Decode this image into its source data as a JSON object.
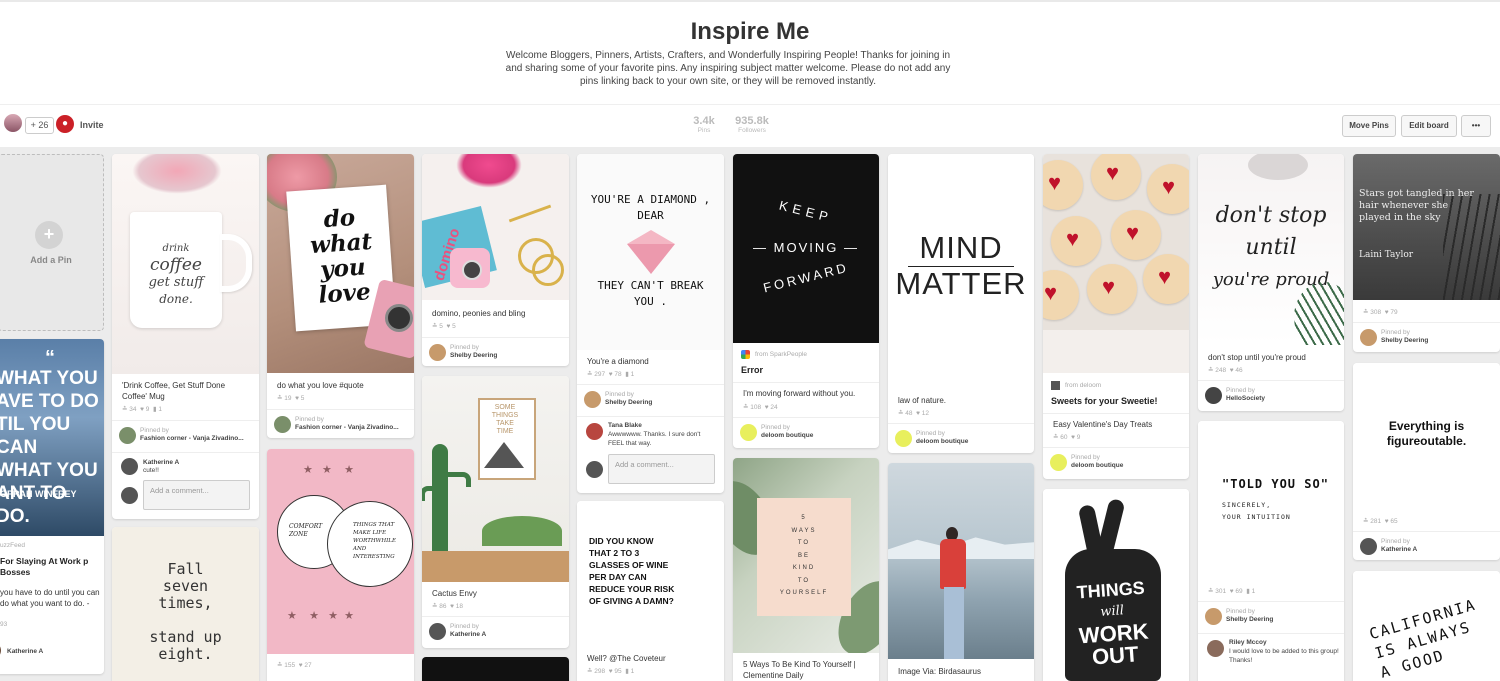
{
  "board": {
    "title": "Inspire Me",
    "description": "Welcome Bloggers, Pinners, Artists, Crafters, and Wonderfully Inspiring People! Thanks for joining in and sharing some of your favorite pins. Any inspiring subject matter welcome. Please do not add any pins linking back to your own site, or they will be removed instantly."
  },
  "toolbar": {
    "collaborators": "+ 26",
    "invite": "Invite",
    "pins_count": "3.4k",
    "pins_label": "Pins",
    "followers_count": "935.8k",
    "followers_label": "Followers",
    "move_pins": "Move Pins",
    "edit_board": "Edit board",
    "more": "•••"
  },
  "add_pin": "Add a Pin",
  "pins": {
    "oprah": {
      "img_text": [
        "“",
        "WHAT YOU",
        "AVE TO DO",
        "TIL YOU CAN",
        "WHAT YOU",
        "ANT TO DO.",
        "OPRAH WINFREY"
      ],
      "source": "uzzFeed",
      "title": "For Slaying At Work p Bosses",
      "desc": "you have to do until you can do what you want to do. -",
      "stats": "93",
      "pinner": "Katherine A"
    },
    "coffee": {
      "img_text": [
        "drink",
        "coffee",
        "get stuff",
        "done."
      ],
      "desc": "'Drink Coffee, Get Stuff Done Coffee' Mug",
      "stats": [
        "34",
        "9",
        "1"
      ],
      "pinned_by": "Pinned by",
      "pinner": "Fashion corner - Vanja Zivadino...",
      "commenter": "Katherine A",
      "comment": "cute!!",
      "comment_placeholder": "Add a comment..."
    },
    "fall": {
      "img_text": [
        "Fall",
        "seven",
        "times,",
        "stand up",
        "eight."
      ]
    },
    "dowhat": {
      "img_text": [
        "do",
        "what",
        "you",
        "love"
      ],
      "desc": "do what you love #quote",
      "stats": [
        "19",
        "5"
      ],
      "pinned_by": "Pinned by",
      "pinner": "Fashion corner - Vanja Zivadino..."
    },
    "comfort": {
      "img_text": [
        "COMFORT ZONE",
        "THINGS THAT MAKE LIFE WORTHWHILE AND INTERESTING"
      ],
      "stats": [
        "155",
        "27"
      ]
    },
    "domino": {
      "img_text": "domino",
      "desc": "domino, peonies and bling",
      "stats": [
        "5",
        "5"
      ],
      "pinned_by": "Pinned by",
      "pinner": "Shelby Deering"
    },
    "cactus": {
      "img_text": [
        "SOME",
        "THINGS",
        "TAKE",
        "TIME"
      ],
      "desc": "Cactus Envy",
      "stats": [
        "86",
        "18"
      ],
      "pinned_by": "Pinned by",
      "pinner": "Katherine A"
    },
    "diamond": {
      "img_text": [
        "YOU'RE A DIAMOND ,",
        "DEAR",
        "THEY CAN'T BREAK",
        "YOU ."
      ],
      "desc": "You're a diamond",
      "stats": [
        "297",
        "78",
        "1"
      ],
      "pinned_by": "Pinned by",
      "pinner": "Shelby Deering",
      "commenter": "Tana Blake",
      "comment": "Awwwwww. Thanks. I sure don't FEEL that way.",
      "comment_placeholder": "Add a comment..."
    },
    "wine": {
      "img_text": [
        "DID YOU KNOW",
        "THAT 2 TO 3",
        "GLASSES OF WINE",
        "PER DAY CAN",
        "REDUCE YOUR RISK",
        "OF GIVING A DAMN?"
      ],
      "desc": "Well? @The Coveteur",
      "stats": [
        "298",
        "95",
        "1"
      ]
    },
    "keep": {
      "img_text": [
        "KEEP",
        "— MOVING —",
        "FORWARD"
      ],
      "source": "from SparkPeople",
      "title": "Error",
      "desc": "I'm moving forward without you.",
      "stats": [
        "108",
        "24"
      ],
      "pinned_by": "Pinned by",
      "pinner": "deloom boutique"
    },
    "kind": {
      "img_text": [
        "5",
        "WAYS",
        "TO",
        "BE",
        "KIND",
        "TO",
        "YOURSELF"
      ],
      "desc": "5 Ways To Be Kind To Yourself | Clementine Daily"
    },
    "mind": {
      "img_text": [
        "MIND",
        "MATTER"
      ],
      "desc": "law of nature.",
      "stats": [
        "48",
        "12"
      ],
      "pinned_by": "Pinned by",
      "pinner": "deloom boutique"
    },
    "lake": {
      "desc": "Image Via: Birdasaurus"
    },
    "sweets": {
      "source": "from deloom",
      "title": "Sweets for your Sweetie!",
      "desc": "Easy Valentine's Day Treats",
      "stats": [
        "60",
        "9"
      ],
      "pinned_by": "Pinned by",
      "pinner": "deloom boutique"
    },
    "things": {
      "img_text": [
        "THINGS",
        "will",
        "WORK",
        "OUT"
      ]
    },
    "dontstop": {
      "img_text": [
        "don't stop",
        "until",
        "you're proud"
      ],
      "desc": "don't stop until you're proud",
      "stats": [
        "248",
        "46"
      ],
      "pinned_by": "Pinned by",
      "pinner": "HelloSociety"
    },
    "toldyou": {
      "img_text": [
        "\"TOLD YOU SO\"",
        "SINCERELY,",
        "YOUR INTUITION"
      ],
      "stats": [
        "301",
        "69",
        "1"
      ],
      "pinned_by": "Pinned by",
      "pinner": "Shelby Deering",
      "commenter": "Riley Mccoy",
      "comment": "I would love to be added to this group! Thanks!"
    },
    "stars": {
      "img_text": [
        "Stars got tangled in her",
        "hair whenever she",
        "played in the sky",
        "Laini Taylor"
      ],
      "stats": [
        "308",
        "79"
      ],
      "pinned_by": "Pinned by",
      "pinner": "Shelby Deering"
    },
    "figure": {
      "img_text": [
        "Everything is",
        "figureoutable."
      ],
      "stats": [
        "281",
        "65"
      ],
      "pinned_by": "Pinned by",
      "pinner": "Katherine A"
    },
    "california": {
      "img_text": [
        "CALIFORNIA",
        "IS ALWAYS",
        "A GOOD"
      ]
    }
  }
}
